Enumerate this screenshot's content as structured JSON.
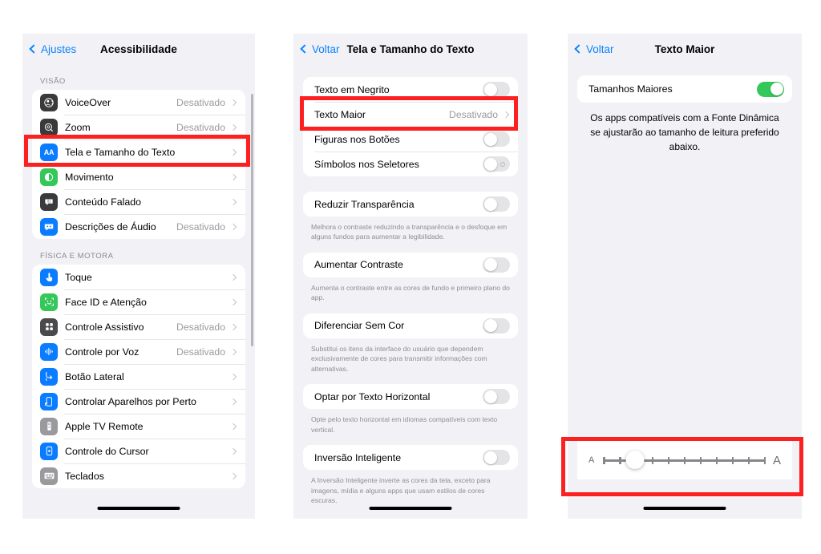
{
  "accent_blue": "#0a84ff",
  "highlight_red": "#fc2020",
  "toggle_green": "#34c759",
  "panel1": {
    "nav": {
      "back_label": "Ajustes",
      "title": "Acessibilidade"
    },
    "sections": [
      {
        "header": "VISÃO",
        "items": [
          {
            "icon": "voiceover-icon",
            "label": "VoiceOver",
            "value": "Desativado"
          },
          {
            "icon": "zoom-icon",
            "label": "Zoom",
            "value": "Desativado"
          },
          {
            "icon": "display-text-size-icon",
            "label": "Tela e Tamanho do Texto",
            "value": ""
          },
          {
            "icon": "motion-icon",
            "label": "Movimento",
            "value": ""
          },
          {
            "icon": "spoken-content-icon",
            "label": "Conteúdo Falado",
            "value": ""
          },
          {
            "icon": "audio-descriptions-icon",
            "label": "Descrições de Áudio",
            "value": "Desativado"
          }
        ]
      },
      {
        "header": "FÍSICA E MOTORA",
        "items": [
          {
            "icon": "touch-icon",
            "label": "Toque",
            "value": ""
          },
          {
            "icon": "face-id-icon",
            "label": "Face ID e Atenção",
            "value": ""
          },
          {
            "icon": "assistive-control-icon",
            "label": "Controle Assistivo",
            "value": "Desativado"
          },
          {
            "icon": "voice-control-icon",
            "label": "Controle por Voz",
            "value": "Desativado"
          },
          {
            "icon": "side-button-icon",
            "label": "Botão Lateral",
            "value": ""
          },
          {
            "icon": "nearby-devices-icon",
            "label": "Controlar Aparelhos por Perto",
            "value": ""
          },
          {
            "icon": "apple-tv-remote-icon",
            "label": "Apple TV Remote",
            "value": ""
          },
          {
            "icon": "pointer-control-icon",
            "label": "Controle do Cursor",
            "value": ""
          },
          {
            "icon": "keyboards-icon",
            "label": "Teclados",
            "value": ""
          }
        ]
      }
    ]
  },
  "panel2": {
    "nav": {
      "back_label": "Voltar",
      "title": "Tela e Tamanho do Texto"
    },
    "group1": [
      {
        "label": "Texto em Negrito",
        "type": "toggle",
        "on": false
      },
      {
        "label": "Texto Maior",
        "type": "disclosure",
        "value": "Desativado"
      },
      {
        "label": "Figuras nos Botões",
        "type": "toggle",
        "on": false
      },
      {
        "label": "Símbolos nos Seletores",
        "type": "toggle-symbol",
        "on": false
      }
    ],
    "blocks": [
      {
        "label": "Reduzir Transparência",
        "on": false,
        "footnote": "Melhora o contraste reduzindo a transparência e o desfoque em alguns fundos para aumentar a legibilidade."
      },
      {
        "label": "Aumentar Contraste",
        "on": false,
        "footnote": "Aumenta o contraste entre as cores de fundo e primeiro plano do app."
      },
      {
        "label": "Diferenciar Sem Cor",
        "on": false,
        "footnote": "Substitui os itens da interface do usuário que dependem exclusivamente de cores para transmitir informações com alternativas."
      },
      {
        "label": "Optar por Texto Horizontal",
        "on": false,
        "footnote": "Opte pelo texto horizontal em idiomas compatíveis com texto vertical."
      },
      {
        "label": "Inversão Inteligente",
        "on": false,
        "footnote": "A Inversão Inteligente inverte as cores da tela, exceto para imagens, mídia e alguns apps que usam estilos de cores escuras."
      }
    ]
  },
  "panel3": {
    "nav": {
      "back_label": "Voltar",
      "title": "Texto Maior"
    },
    "toggle_row": {
      "label": "Tamanhos Maiores",
      "on": true
    },
    "description": "Os apps compatíveis com a Fonte Dinâmica se ajustarão ao tamanho de leitura preferido abaixo.",
    "slider": {
      "min_label": "A",
      "max_label": "A",
      "ticks": 11,
      "position_index": 2,
      "value_percent": 20
    }
  }
}
